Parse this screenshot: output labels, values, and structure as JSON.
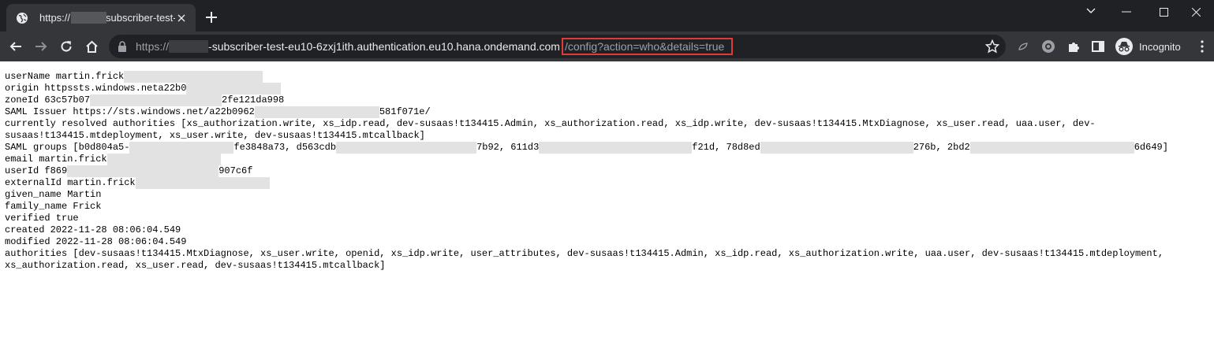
{
  "tab": {
    "title_start": "https://",
    "title_end": "subscriber-test-e",
    "favicon": "globe-icon",
    "close": "close-icon"
  },
  "window_controls": [
    "minimize-icon",
    "maximize-icon",
    "close-icon"
  ],
  "toolbar": {
    "url_scheme": "https://",
    "url_host_rest": "-subscriber-test-eu10-6zxj1ith.authentication.eu10.hana.ondemand.com",
    "url_path": "/config?action=who&details=true",
    "highlight_color": "#e03a3a",
    "profile_label": "Incognito"
  },
  "page": {
    "lines": [
      {
        "parts": [
          {
            "t": "userName martin.frick"
          },
          {
            "r": 176
          }
        ]
      },
      {
        "parts": [
          {
            "t": "origin httpssts.windows.neta22b0"
          },
          {
            "r": 120
          }
        ]
      },
      {
        "parts": [
          {
            "t": "zoneId 63c57b07"
          },
          {
            "r": 167
          },
          {
            "t": "2fe121da998"
          }
        ]
      },
      {
        "parts": [
          {
            "t": "SAML Issuer https://sts.windows.net/a22b0962"
          },
          {
            "r": 158
          },
          {
            "t": "581f071e/"
          }
        ]
      },
      {
        "parts": [
          {
            "t": "currently resolved authorities [xs_authorization.write, xs_idp.read, dev-susaas!t134415.Admin, xs_authorization.read, xs_idp.write, dev-susaas!t134415.MtxDiagnose, xs_user.read, uaa.user, dev-"
          }
        ]
      },
      {
        "parts": [
          {
            "t": "susaas!t134415.mtdeployment, xs_user.write, dev-susaas!t134415.mtcallback]"
          }
        ]
      },
      {
        "parts": [
          {
            "t": "SAML groups [b0d804a5-"
          },
          {
            "r": 132
          },
          {
            "t": "fe3848a73, d563cdb"
          },
          {
            "r": 178
          },
          {
            "t": "7b92, 611d3"
          },
          {
            "r": 194
          },
          {
            "t": "f21d, 78d8ed"
          },
          {
            "r": 194
          },
          {
            "t": "276b, 2bd2"
          },
          {
            "r": 208
          },
          {
            "t": "6d649]"
          }
        ]
      },
      {
        "parts": [
          {
            "t": "email martin.frick"
          },
          {
            "r": 144
          }
        ]
      },
      {
        "parts": [
          {
            "t": "userId f869"
          },
          {
            "r": 192
          },
          {
            "t": "907c6f"
          }
        ]
      },
      {
        "parts": [
          {
            "t": "externalId martin.frick"
          },
          {
            "r": 170
          }
        ]
      },
      {
        "parts": [
          {
            "t": "given_name Martin"
          }
        ]
      },
      {
        "parts": [
          {
            "t": "family_name Frick"
          }
        ]
      },
      {
        "parts": [
          {
            "t": "verified true"
          }
        ]
      },
      {
        "parts": [
          {
            "t": "created 2022-11-28 08:06:04.549"
          }
        ]
      },
      {
        "parts": [
          {
            "t": "modified 2022-11-28 08:06:04.549"
          }
        ]
      },
      {
        "parts": [
          {
            "t": "authorities [dev-susaas!t134415.MtxDiagnose, xs_user.write, openid, xs_idp.write, user_attributes, dev-susaas!t134415.Admin, xs_idp.read, xs_authorization.write, uaa.user, dev-susaas!t134415.mtdeployment,"
          }
        ]
      },
      {
        "parts": [
          {
            "t": "xs_authorization.read, xs_user.read, dev-susaas!t134415.mtcallback]"
          }
        ]
      }
    ]
  }
}
